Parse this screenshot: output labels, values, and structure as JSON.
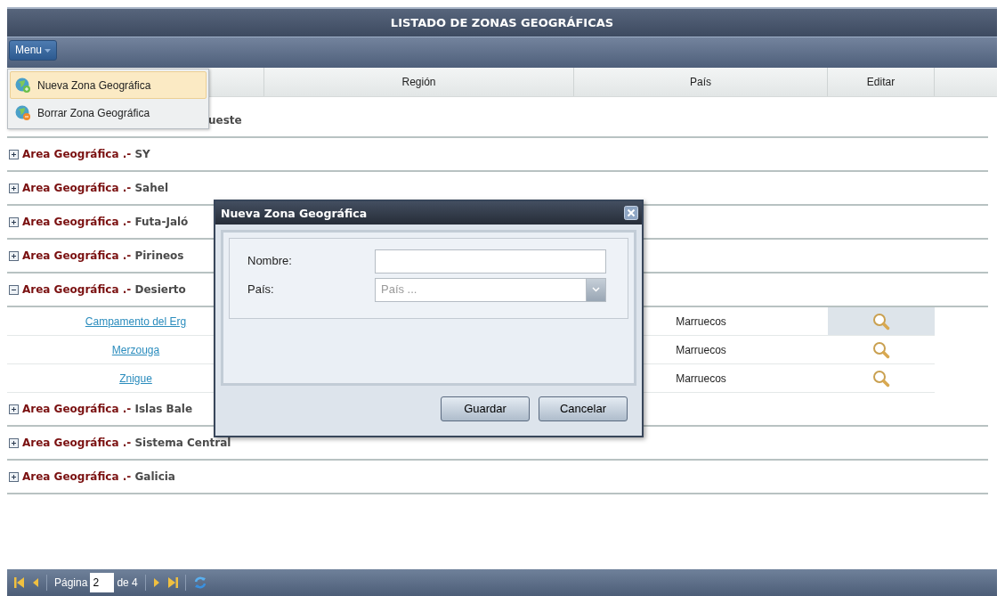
{
  "title": "LISTADO DE ZONAS GEOGRÁFICAS",
  "menu_button": {
    "label": "Menu",
    "open": true
  },
  "menu_items": [
    {
      "label": "Nueva Zona Geográfica",
      "kind": "add",
      "selected": true
    },
    {
      "label": "Borrar Zona Geográfica",
      "kind": "remove",
      "selected": false
    }
  ],
  "columns": [
    "Región",
    "País",
    "Editar"
  ],
  "groups": [
    {
      "name": "ueste"
    },
    {
      "prefix": "Area Geográfica .-",
      "name": "SY",
      "expanded": false
    },
    {
      "prefix": "Area Geográfica .-",
      "name": "Sahel",
      "expanded": false
    },
    {
      "prefix": "Area Geográfica .-",
      "name": "Futa-Jaló",
      "expanded": false
    },
    {
      "prefix": "Area Geográfica .-",
      "name": "Pirineos",
      "expanded": false
    },
    {
      "prefix": "Area Geográfica .-",
      "name": "Desierto",
      "expanded": true,
      "rows": [
        {
          "nombre": "Campamento del Erg",
          "pais": "Marruecos",
          "highlighted": true
        },
        {
          "nombre": "Merzouga",
          "pais": "Marruecos",
          "highlighted": false
        },
        {
          "nombre": "Znigue",
          "pais": "Marruecos",
          "highlighted": false
        }
      ]
    },
    {
      "prefix": "Area Geográfica .-",
      "name": "Islas Bale",
      "expanded": false
    },
    {
      "prefix": "Area Geográfica .-",
      "name": "Sistema Central",
      "expanded": false
    },
    {
      "prefix": "Area Geográfica .-",
      "name": "Galicia",
      "expanded": false
    }
  ],
  "dialog": {
    "title": "Nueva Zona Geográfica",
    "fields": [
      {
        "label": "Nombre:",
        "kind": "text"
      },
      {
        "label": "País:",
        "kind": "combo",
        "placeholder": "País ..."
      }
    ],
    "buttons": [
      "Guardar",
      "Cancelar"
    ]
  },
  "pager": {
    "page_label": "Página",
    "page": "2",
    "total_label": "de 4"
  }
}
